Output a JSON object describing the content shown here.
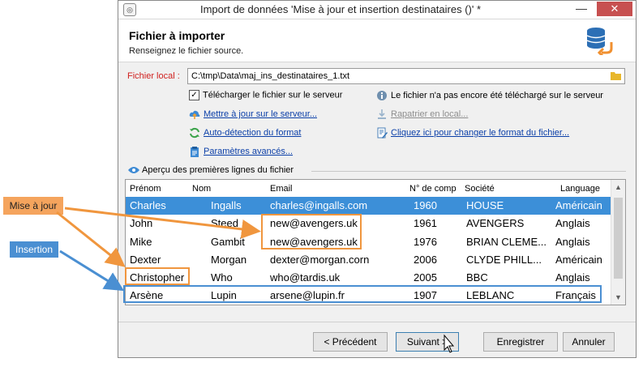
{
  "window": {
    "title": "Import de données 'Mise à jour et insertion destinataires ()' *",
    "minimize_glyph": "—",
    "close_glyph": "✕"
  },
  "header": {
    "title": "Fichier à importer",
    "subtitle": "Renseignez le fichier source."
  },
  "file": {
    "label": "Fichier local :",
    "path": "C:\\tmp\\Data\\maj_ins_destinataires_1.txt"
  },
  "options": {
    "upload_checkbox_label": "Télécharger le fichier sur le serveur",
    "upload_checked": true,
    "not_uploaded_info": "Le fichier n'a pas encore été téléchargé sur le serveur",
    "update_on_server": "Mettre à jour sur le serveur...",
    "repatriate_local": "Rapatrier en local...",
    "auto_detect": "Auto-détection du format",
    "change_format": "Cliquez ici pour changer le format du fichier...",
    "advanced_params": "Paramètres avancés..."
  },
  "preview": {
    "section_label": "Aperçu des premières lignes du fichier",
    "columns": [
      "Prénom",
      "Nom",
      "Email",
      "N° de comp",
      "Société",
      "Language"
    ],
    "rows": [
      [
        "Charles",
        "Ingalls",
        "charles@ingalls.com",
        "1960",
        "HOUSE",
        "Américain"
      ],
      [
        "John",
        "Steed",
        "new@avengers.uk",
        "1961",
        "AVENGERS",
        "Anglais"
      ],
      [
        "Mike",
        "Gambit",
        "new@avengers.uk",
        "1976",
        "BRIAN CLEME...",
        "Anglais"
      ],
      [
        "Dexter",
        "Morgan",
        "dexter@morgan.corn",
        "2006",
        "CLYDE PHILL...",
        "Américain"
      ],
      [
        "Christopher",
        "Who",
        "who@tardis.uk",
        "2005",
        "BBC",
        "Anglais"
      ],
      [
        "Arsène",
        "Lupin",
        "arsene@lupin.fr",
        "1907",
        "LEBLANC",
        "Français"
      ]
    ],
    "selected_row": 0
  },
  "buttons": {
    "previous": "< Précédent",
    "next": "Suivant >",
    "save": "Enregistrer",
    "cancel": "Annuler"
  },
  "annotations": {
    "update_label": "Mise à jour",
    "insert_label": "Insertion"
  },
  "colors": {
    "selection": "#3c8fd8",
    "link": "#0b3fa8",
    "error_label": "#d0201e",
    "callout_update": "#f5a45d",
    "callout_insert": "#4a8fd2"
  }
}
